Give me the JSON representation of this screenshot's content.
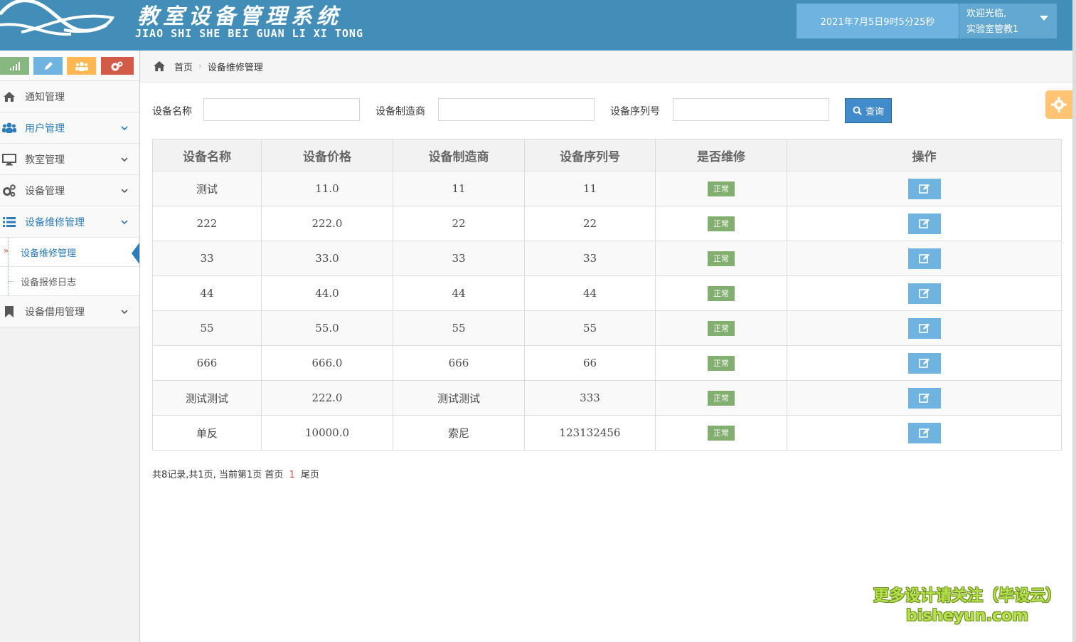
{
  "header": {
    "title": "教室设备管理系统",
    "subtitle": "JIAO SHI SHE BEI GUAN LI XI TONG",
    "datetime": "2021年7月5日9时5分25秒",
    "welcome": "欢迎光临,",
    "username": "实验室管教1"
  },
  "sidebar": {
    "shortcuts": [
      {
        "icon": "signal-icon",
        "color": "#87b87f"
      },
      {
        "icon": "pencil-icon",
        "color": "#6fb3e0"
      },
      {
        "icon": "users-icon",
        "color": "#ffb752"
      },
      {
        "icon": "cogs-icon",
        "color": "#d15b47"
      }
    ],
    "items": [
      {
        "label": "通知管理",
        "icon": "home-icon"
      },
      {
        "label": "用户管理",
        "icon": "users-icon"
      },
      {
        "label": "教室管理",
        "icon": "desktop-icon"
      },
      {
        "label": "设备管理",
        "icon": "cogs-icon"
      },
      {
        "label": "设备维修管理",
        "icon": "list-icon"
      },
      {
        "label": "设备借用管理",
        "icon": "bookmark-icon"
      }
    ],
    "subitems": [
      {
        "label": "设备维修管理",
        "active": true
      },
      {
        "label": "设备报修日志",
        "active": false
      }
    ]
  },
  "breadcrumb": {
    "home": "首页",
    "current": "设备维修管理"
  },
  "search": {
    "name_label": "设备名称",
    "maker_label": "设备制造商",
    "serial_label": "设备序列号",
    "name_value": "",
    "maker_value": "",
    "serial_value": "",
    "button": "查询"
  },
  "table": {
    "columns": [
      "设备名称",
      "设备价格",
      "设备制造商",
      "设备序列号",
      "是否维修",
      "操作"
    ],
    "rows": [
      {
        "name": "测试",
        "price": "11.0",
        "maker": "11",
        "serial": "11",
        "status": "正常"
      },
      {
        "name": "222",
        "price": "222.0",
        "maker": "22",
        "serial": "22",
        "status": "正常"
      },
      {
        "name": "33",
        "price": "33.0",
        "maker": "33",
        "serial": "33",
        "status": "正常"
      },
      {
        "name": "44",
        "price": "44.0",
        "maker": "44",
        "serial": "44",
        "status": "正常"
      },
      {
        "name": "55",
        "price": "55.0",
        "maker": "55",
        "serial": "55",
        "status": "正常"
      },
      {
        "name": "666",
        "price": "666.0",
        "maker": "666",
        "serial": "66",
        "status": "正常"
      },
      {
        "name": "测试测试",
        "price": "222.0",
        "maker": "测试测试",
        "serial": "333",
        "status": "正常"
      },
      {
        "name": "单反",
        "price": "10000.0",
        "maker": "索尼",
        "serial": "123132456",
        "status": "正常"
      }
    ]
  },
  "pager": {
    "summary": "共8记录,共1页, 当前第1页",
    "first": "首页",
    "current": "1",
    "last": "尾页"
  },
  "watermark": {
    "line1": "更多设计请关注（毕设云）",
    "line2": "bisheyun.com"
  }
}
